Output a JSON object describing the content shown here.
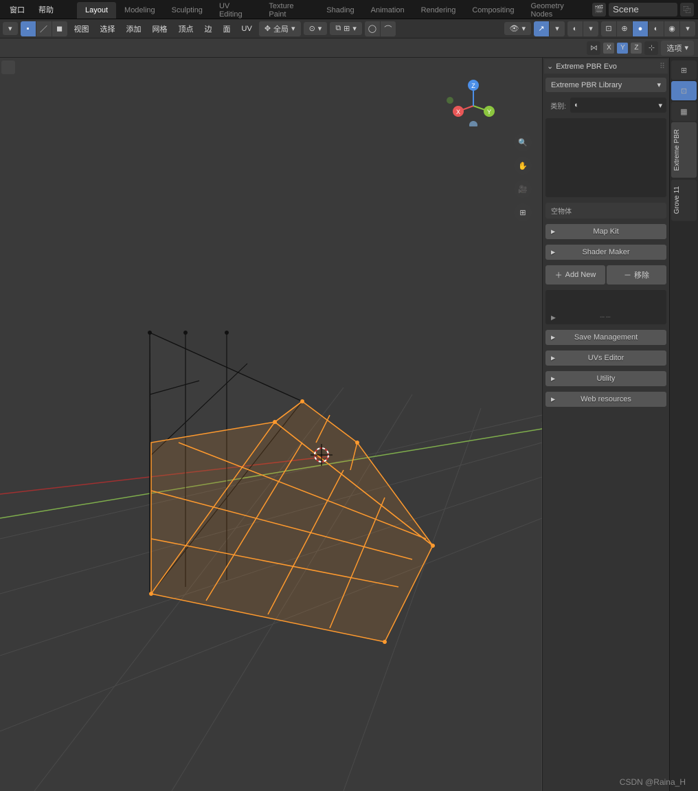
{
  "menu": {
    "window": "窗口",
    "help": "帮助"
  },
  "workspaces": [
    "Layout",
    "Modeling",
    "Sculpting",
    "UV Editing",
    "Texture Paint",
    "Shading",
    "Animation",
    "Rendering",
    "Compositing",
    "Geometry Nodes"
  ],
  "active_workspace": 0,
  "scene_name": "Scene",
  "toolbar": {
    "view": "视图",
    "select": "选择",
    "add": "添加",
    "mesh": "网格",
    "vertex": "顶点",
    "edge": "边",
    "face": "面",
    "uv": "UV",
    "orient": "全局",
    "options": "选项"
  },
  "axes": {
    "x": "X",
    "y": "Y",
    "z": "Z"
  },
  "gizmo": {
    "x": "X",
    "y": "Y",
    "z": "Z"
  },
  "panel": {
    "title": "Extreme PBR Evo",
    "library": "Extreme PBR Library",
    "category_label": "类别:",
    "empty": "空物体",
    "mapkit": "Map Kit",
    "shadermaker": "Shader Maker",
    "addnew": "Add New",
    "remove": "移除",
    "savemgmt": "Save Management",
    "uvseditor": "UVs Editor",
    "utility": "Utility",
    "webres": "Web resources"
  },
  "sidetabs": {
    "t1": "",
    "t2": "",
    "t3": "Extreme PBR",
    "t4": "Grove 11"
  },
  "watermark": "CSDN @Raina_H"
}
